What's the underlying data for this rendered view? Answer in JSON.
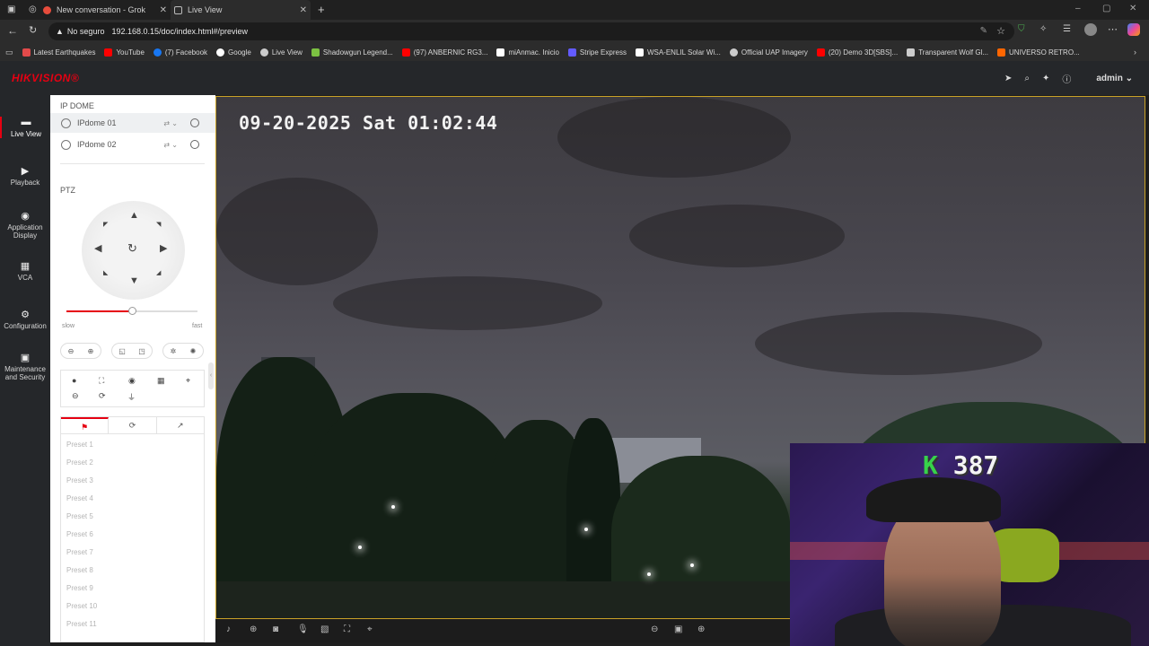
{
  "browser": {
    "tabs": [
      {
        "title": "New conversation - Grok"
      },
      {
        "title": "Live View"
      }
    ],
    "security_label": "No seguro",
    "url": "192.168.0.15/doc/index.html#/preview",
    "bookmarks": [
      {
        "label": "Latest Earthquakes",
        "color": "#e24a4a"
      },
      {
        "label": "YouTube",
        "color": "#ff0000"
      },
      {
        "label": "(7) Facebook",
        "color": "#1877f2"
      },
      {
        "label": "Google",
        "color": "#ffffff"
      },
      {
        "label": "Live View",
        "color": "#cccccc"
      },
      {
        "label": "Shadowgun Legend...",
        "color": "#7cc142"
      },
      {
        "label": "(97) ANBERNIC RG3...",
        "color": "#ff0000"
      },
      {
        "label": "miAnmac. Inicio",
        "color": "#ffffff"
      },
      {
        "label": "Stripe Express",
        "color": "#635bff"
      },
      {
        "label": "WSA-ENLIL Solar Wi...",
        "color": "#ffffff"
      },
      {
        "label": "Official UAP Imagery",
        "color": "#cccccc"
      },
      {
        "label": "(20) Demo 3D[SBS]...",
        "color": "#ff0000"
      },
      {
        "label": "Transparent Wolf Gl...",
        "color": "#cccccc"
      },
      {
        "label": "UNIVERSO RETRO...",
        "color": "#ff6600"
      }
    ]
  },
  "app": {
    "logo": "HIKVISION®",
    "user": "admin"
  },
  "nav": [
    {
      "label": "Live View",
      "active": true
    },
    {
      "label": "Playback"
    },
    {
      "label": "Application Display"
    },
    {
      "label": "VCA"
    },
    {
      "label": "Configuration"
    },
    {
      "label": "Maintenance and Security"
    }
  ],
  "panel": {
    "section_title": "IP DOME",
    "cameras": [
      "IPdome 01",
      "IPdome 02"
    ],
    "ptz_title": "PTZ",
    "speed": {
      "min_label": "slow",
      "max_label": "fast",
      "value": 0.5
    },
    "preset_tabs": [
      "flag-icon",
      "cycle-icon",
      "trend-icon"
    ],
    "presets": [
      "Preset 1",
      "Preset 2",
      "Preset 3",
      "Preset 4",
      "Preset 5",
      "Preset 6",
      "Preset 7",
      "Preset 8",
      "Preset 9",
      "Preset 10",
      "Preset 11"
    ]
  },
  "video": {
    "osd_timestamp": "09-20-2025 Sat 01:02:44"
  },
  "overlay": {
    "k_label": "K",
    "count": "387"
  }
}
